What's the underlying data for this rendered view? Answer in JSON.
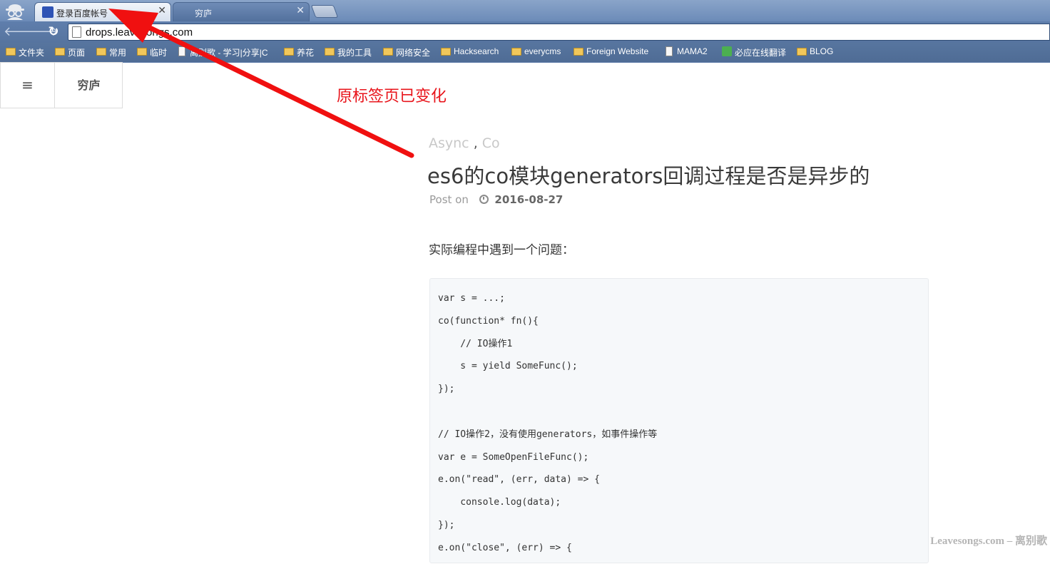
{
  "browser": {
    "tabs": [
      {
        "title": "登录百度帐号",
        "active": true
      },
      {
        "title": "穷庐",
        "active": false
      }
    ],
    "url": "drops.leavesongs.com",
    "bookmarks": [
      {
        "label": "文件夹",
        "icon": "folder-icon"
      },
      {
        "label": "页面",
        "icon": "folder-icon"
      },
      {
        "label": "常用",
        "icon": "folder-icon"
      },
      {
        "label": "临时",
        "icon": "folder-icon"
      },
      {
        "label": "离别歌 - 学习|分享|C",
        "icon": "page-icon"
      },
      {
        "label": "养花",
        "icon": "folder-icon"
      },
      {
        "label": "我的工具",
        "icon": "folder-icon"
      },
      {
        "label": "网络安全",
        "icon": "folder-icon"
      },
      {
        "label": "Hacksearch",
        "icon": "folder-icon"
      },
      {
        "label": "everycms",
        "icon": "folder-icon"
      },
      {
        "label": "Foreign Website",
        "icon": "folder-icon"
      },
      {
        "label": "MAMA2",
        "icon": "file-icon"
      },
      {
        "label": "必应在线翻译",
        "icon": "app-icon"
      },
      {
        "label": "BLOG",
        "icon": "folder-icon"
      }
    ],
    "accent": "#5c7aa8"
  },
  "site": {
    "menu_glyph": "≡",
    "name": "穷庐"
  },
  "annotation": {
    "text": "原标签页已变化",
    "color": "#e8141b"
  },
  "post": {
    "tags": [
      "Async",
      "Co"
    ],
    "title": "es6的co模块generators回调过程是否是异步的",
    "post_on_label": "Post on",
    "date": "2016-08-27",
    "intro": "实际编程中遇到一个问题：",
    "code_lines": [
      "var s = ...;",
      "co(function* fn(){",
      "    // IO操作1",
      "    s = yield SomeFunc();",
      "});",
      "",
      "// IO操作2，没有使用generators，如事件操作等",
      "var e = SomeOpenFileFunc();",
      "e.on(\"read\", (err, data) => {",
      "    console.log(data);",
      "});",
      "e.on(\"close\", (err) => {"
    ]
  },
  "watermark": "Leavesongs.com – 离别歌"
}
